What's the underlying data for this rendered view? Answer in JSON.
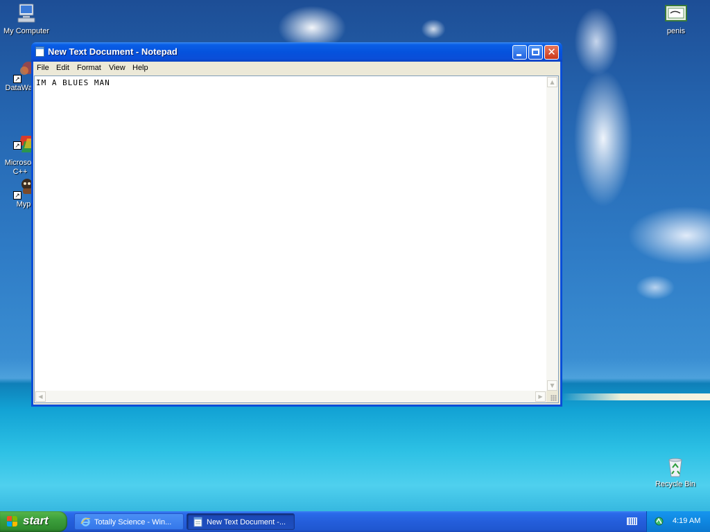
{
  "desktop": {
    "icons": [
      {
        "label": "My Computer"
      },
      {
        "label": "DataWar"
      },
      {
        "label": "Microsoft\nC++"
      },
      {
        "label": "Myp"
      },
      {
        "label": "penis"
      },
      {
        "label": "Recycle Bin"
      }
    ]
  },
  "window": {
    "title": "New Text Document - Notepad",
    "menu": [
      "File",
      "Edit",
      "Format",
      "View",
      "Help"
    ],
    "content": "IM A BLUES MAN"
  },
  "taskbar": {
    "start_label": "start",
    "tasks": [
      {
        "label": "Totally Science - Win..."
      },
      {
        "label": "New Text Document -..."
      }
    ],
    "clock": "4:19 AM"
  },
  "colors": {
    "titlebar": "#0a4ed8",
    "taskbar": "#245edb",
    "start_button": "#3c9f3c",
    "close_button": "#c9381a"
  }
}
